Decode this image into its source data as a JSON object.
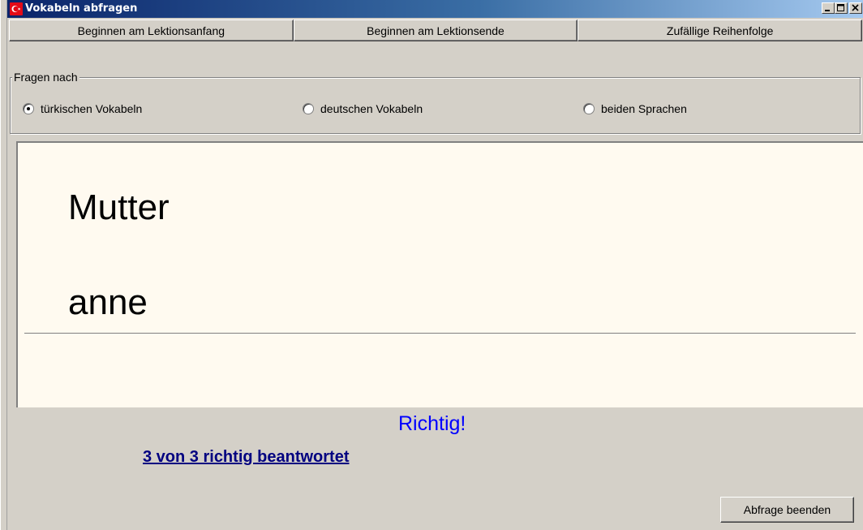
{
  "window": {
    "title": "Vokabeln abfragen",
    "icon": "turkish-flag-icon"
  },
  "toolbar": {
    "buttons": [
      {
        "label": "Beginnen am Lektionsanfang"
      },
      {
        "label": "Beginnen am Lektionsende"
      },
      {
        "label": "Zufällige Reihenfolge"
      }
    ]
  },
  "ask_group": {
    "legend": "Fragen nach",
    "options": [
      {
        "label": "türkischen Vokabeln",
        "checked": true
      },
      {
        "label": "deutschen Vokabeln",
        "checked": false
      },
      {
        "label": "beiden Sprachen",
        "checked": false
      }
    ]
  },
  "card": {
    "question": "Mutter",
    "answer": "anne"
  },
  "status": {
    "result": "Richtig!",
    "score": "3 von 3 richtig beantwortet"
  },
  "footer": {
    "end_label": "Abfrage beenden"
  },
  "colors": {
    "result": "#0000ff",
    "score": "#000080",
    "card_bg": "#fffaf0",
    "flag": "#e30a17"
  }
}
